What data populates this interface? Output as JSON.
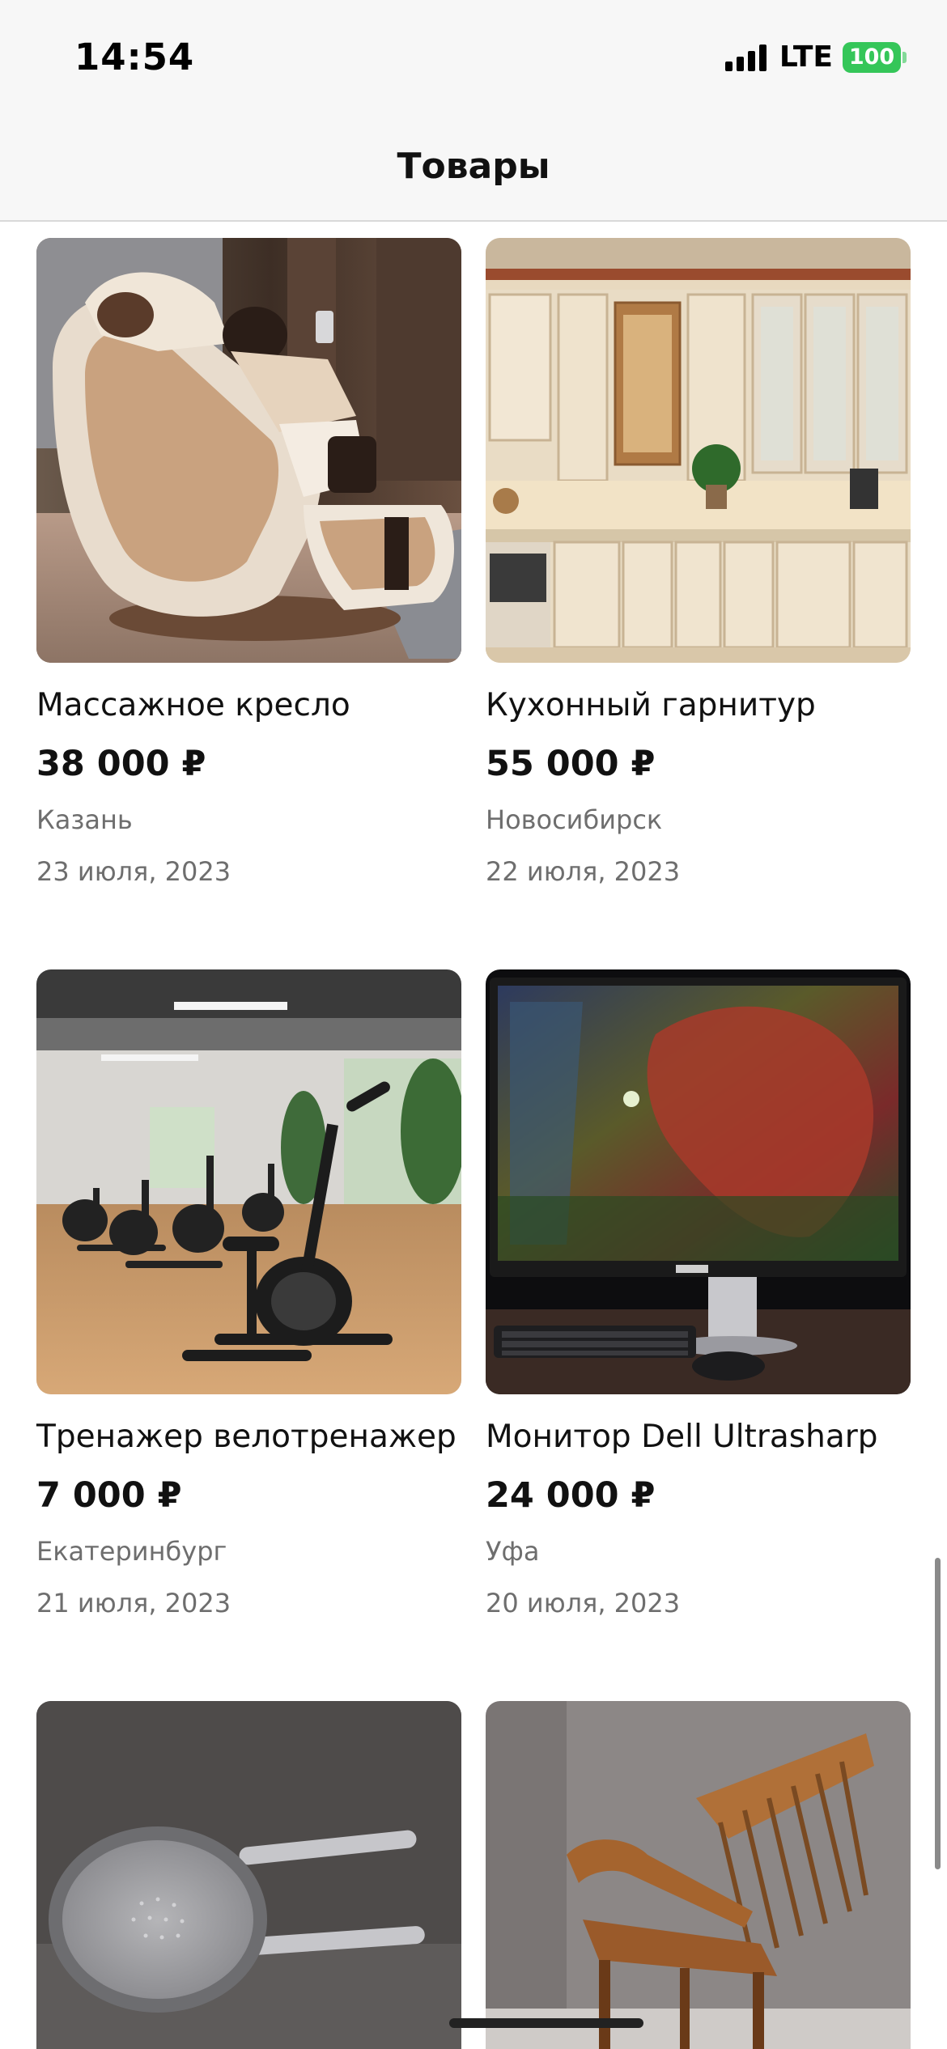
{
  "status_bar": {
    "time": "14:54",
    "network": "LTE",
    "battery": "100"
  },
  "header": {
    "title": "Товары"
  },
  "products": [
    {
      "title": "Массажное кресло",
      "price": "38 000 ₽",
      "city": "Казань",
      "date": "23 июля, 2023",
      "image_icon": "massage-chair"
    },
    {
      "title": "Кухонный гарнитур",
      "price": "55 000 ₽",
      "city": "Новосибирск",
      "date": "22 июля, 2023",
      "image_icon": "kitchen-set"
    },
    {
      "title": "Тренажер велотренажер",
      "price": "7 000 ₽",
      "city": "Екатеринбург",
      "date": "21 июля, 2023",
      "image_icon": "exercise-bike"
    },
    {
      "title": "Монитор Dell Ultrasharp",
      "price": "24 000 ₽",
      "city": "Уфа",
      "date": "20 июля, 2023",
      "image_icon": "monitor"
    },
    {
      "title": "",
      "price": "",
      "city": "",
      "date": "",
      "image_icon": "frying-pan"
    },
    {
      "title": "",
      "price": "",
      "city": "",
      "date": "",
      "image_icon": "rocking-chair"
    }
  ],
  "colors": {
    "battery": "#35c659",
    "secondary_text": "#6e6e6e"
  }
}
